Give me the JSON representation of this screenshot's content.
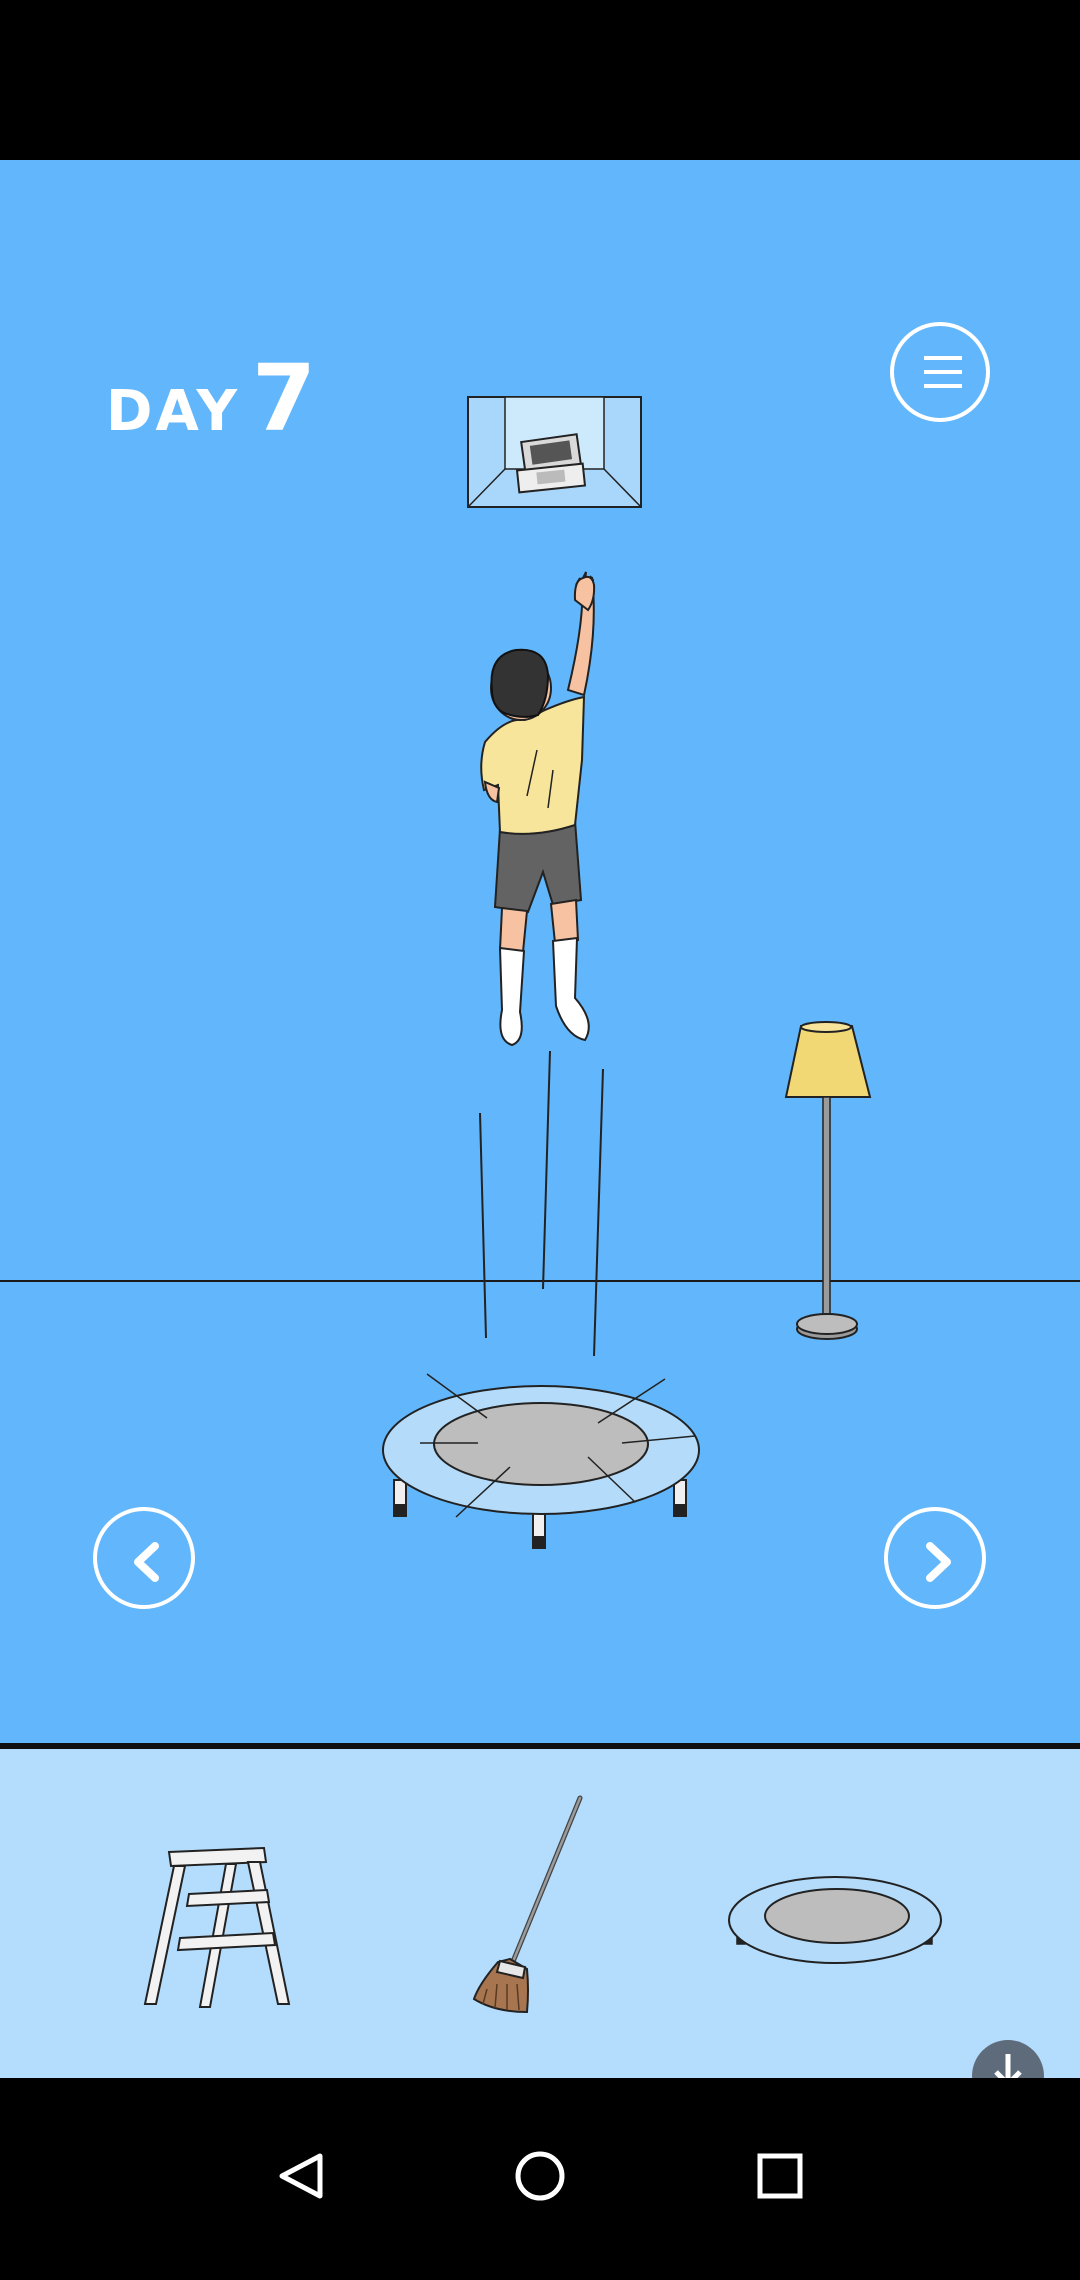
{
  "header": {
    "day_word": "DAY",
    "day_number": "7"
  },
  "icons": {
    "menu": "hamburger-menu-icon",
    "prev": "chevron-left-icon",
    "next": "chevron-right-icon",
    "download": "download-icon",
    "nav_back": "triangle-back-icon",
    "nav_home": "circle-home-icon",
    "nav_recents": "square-recents-icon"
  },
  "inventory": {
    "items": [
      {
        "name": "step-ladder"
      },
      {
        "name": "broom"
      },
      {
        "name": "trampoline"
      }
    ]
  },
  "colors": {
    "scene_background": "#62b6fb",
    "inventory_background": "#b3dcfd",
    "lamp_shade": "#f2d775",
    "shirt": "#f7e59b",
    "shorts": "#636363",
    "trampoline_frame": "#b4dcfa",
    "trampoline_mat": "#bdbdbd"
  }
}
